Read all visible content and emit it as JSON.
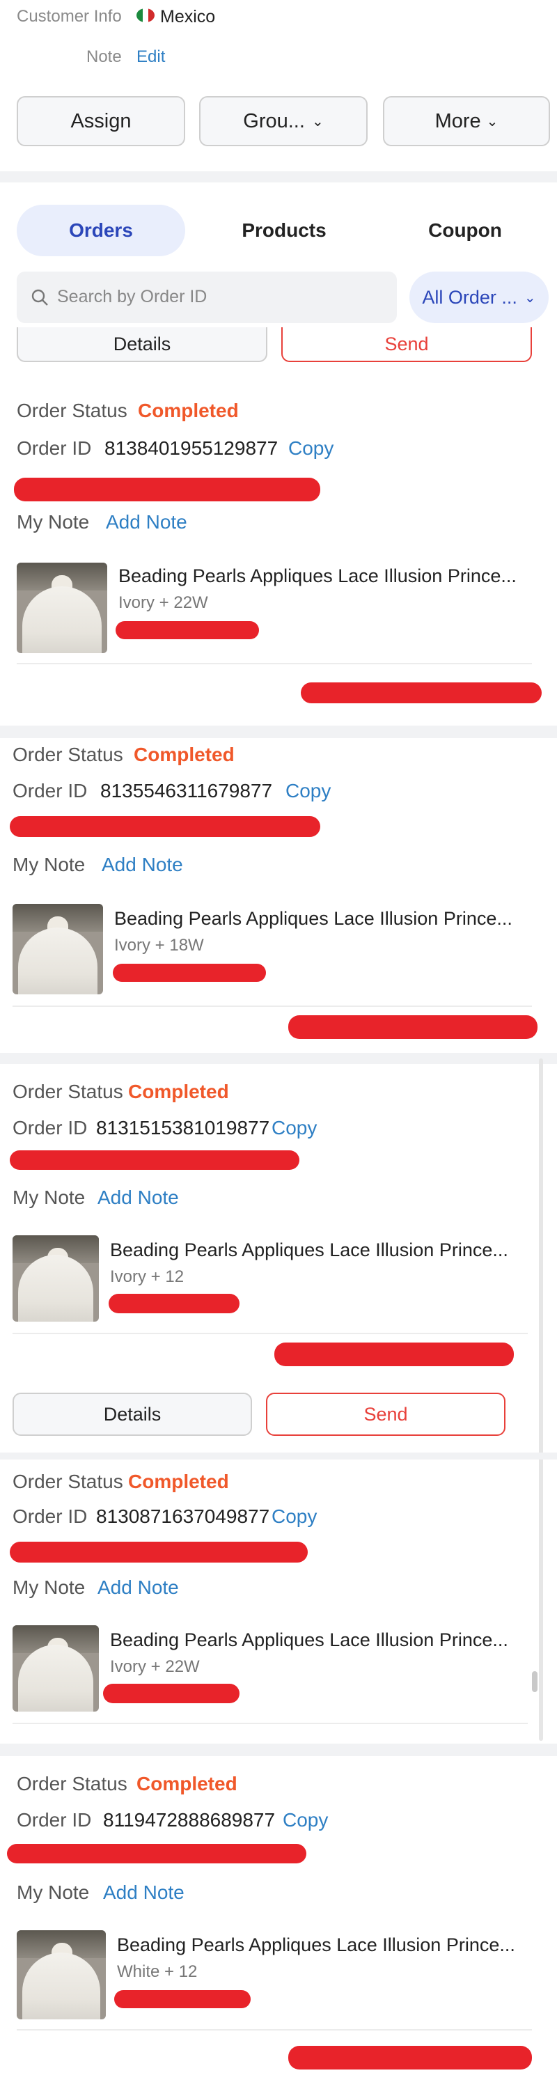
{
  "customer": {
    "info_label": "Customer Info",
    "country": "Mexico",
    "note_label": "Note",
    "note_edit": "Edit"
  },
  "actions": {
    "assign": "Assign",
    "group": "Grou...",
    "more": "More"
  },
  "tabs": [
    "Orders",
    "Products",
    "Coupon"
  ],
  "search": {
    "placeholder": "Search by Order ID",
    "filter": "All Order ..."
  },
  "buttons": {
    "details": "Details",
    "send": "Send"
  },
  "labels": {
    "order_status": "Order Status",
    "order_id": "Order ID",
    "copy": "Copy",
    "my_note": "My Note",
    "add_note": "Add Note"
  },
  "orders": [
    {
      "status": "Completed",
      "order_id": "8138401955129877",
      "product": "Beading Pearls Appliques Lace Illusion Prince...",
      "variant": "Ivory + 22W"
    },
    {
      "status": "Completed",
      "order_id": "8135546311679877",
      "product": "Beading Pearls Appliques Lace Illusion Prince...",
      "variant": "Ivory + 18W"
    },
    {
      "status": "Completed",
      "order_id": "8131515381019877",
      "product": "Beading Pearls Appliques Lace Illusion Prince...",
      "variant": "Ivory + 12"
    },
    {
      "status": "Completed",
      "order_id": "8130871637049877",
      "product": "Beading Pearls Appliques Lace Illusion Prince...",
      "variant": "Ivory + 22W"
    },
    {
      "status": "Completed",
      "order_id": "8119472888689877",
      "product": "Beading Pearls Appliques Lace Illusion Prince...",
      "variant": "White + 12"
    }
  ],
  "colors": {
    "accent_blue": "#2e7fc4",
    "status_orange": "#f0582a",
    "tab_active_bg": "#e9eefc",
    "redaction": "#e8232a"
  }
}
